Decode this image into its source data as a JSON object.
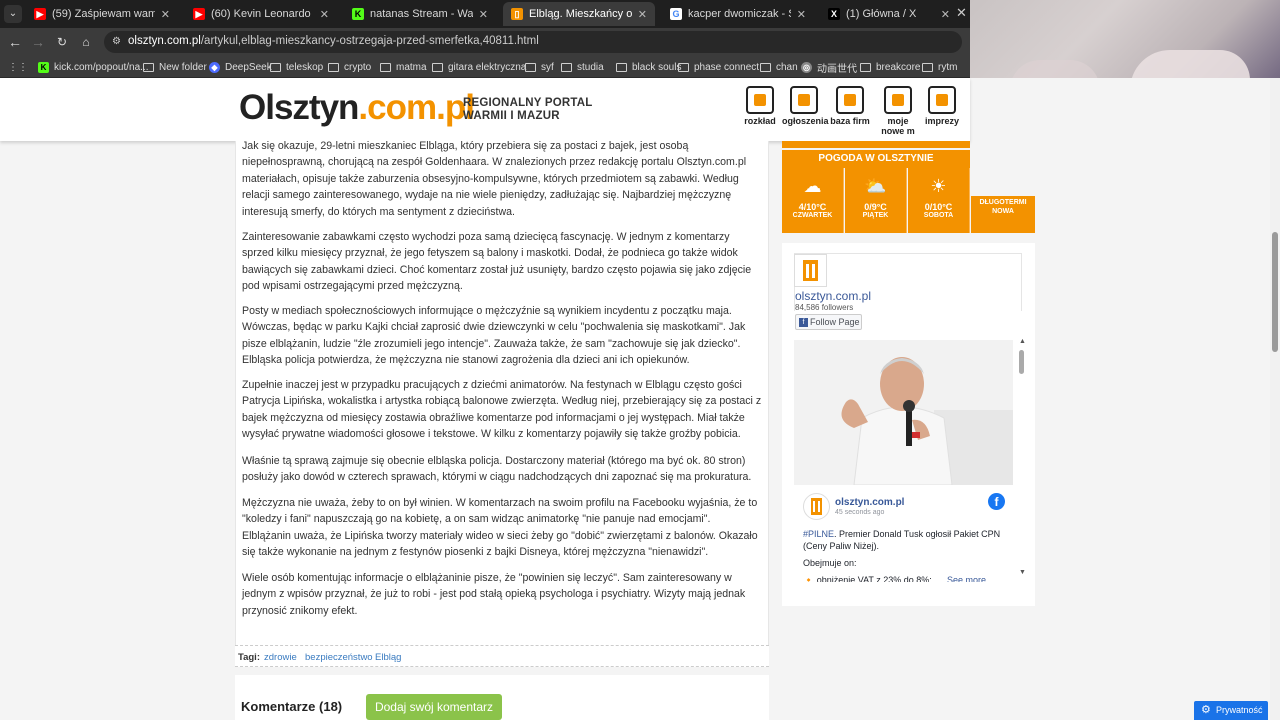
{
  "browser": {
    "tabs": [
      {
        "title": "(59) Zaśpiewam wam utwór Bu",
        "favicon_color": "#ff0000",
        "favicon_glyph": "▶",
        "active": false
      },
      {
        "title": "(60) Kevin Leonardo - YouTube",
        "favicon_color": "#ff0000",
        "favicon_glyph": "▶",
        "active": false
      },
      {
        "title": "natanas Stream - Watch Live on",
        "favicon_color": "#53fc18",
        "favicon_glyph": "K",
        "active": false
      },
      {
        "title": "Elbląg. Mieszkańcy ostrzegają p",
        "favicon_color": "#f39200",
        "favicon_glyph": "▯",
        "active": true
      },
      {
        "title": "kacper dwomiczak - Szukaj w G",
        "favicon_color": "#ffffff",
        "favicon_glyph": "G",
        "active": false
      },
      {
        "title": "(1) Główna / X",
        "favicon_color": "#000000",
        "favicon_glyph": "X",
        "active": false
      }
    ],
    "url_domain": "olsztyn.com.pl",
    "url_path": "/artykul,elblag-mieszkancy-ostrzegaja-przed-smerfetka,40811.html",
    "bookmarks": [
      {
        "label": "kick.com/popout/na...",
        "type": "kick",
        "color": "#53fc18"
      },
      {
        "label": "New folder",
        "type": "folder"
      },
      {
        "label": "DeepSeek",
        "type": "deepseek",
        "color": "#4d6bfe"
      },
      {
        "label": "teleskop",
        "type": "folder"
      },
      {
        "label": "crypto",
        "type": "folder"
      },
      {
        "label": "matma",
        "type": "folder"
      },
      {
        "label": "gitara elektryczna",
        "type": "folder"
      },
      {
        "label": "syf",
        "type": "folder"
      },
      {
        "label": "studia",
        "type": "folder"
      },
      {
        "label": "black souls",
        "type": "folder"
      },
      {
        "label": "phase connect",
        "type": "folder"
      },
      {
        "label": "chan",
        "type": "folder"
      },
      {
        "label": "动画世代",
        "type": "globe",
        "color": "#888888"
      },
      {
        "label": "breakcore",
        "type": "folder"
      },
      {
        "label": "rytm",
        "type": "folder"
      }
    ]
  },
  "site": {
    "logo_main": "Olsztyn",
    "logo_accent": ".com.pl",
    "tagline_line1": "REGIONALNY PORTAL",
    "tagline_line2": "WARMII I MAZUR",
    "nav": [
      {
        "label": "rozkład",
        "icon": "tram-icon"
      },
      {
        "label": "ogłoszenia",
        "icon": "ads-icon"
      },
      {
        "label": "baza firm",
        "icon": "list-icon"
      },
      {
        "label": "moje\nnowe m",
        "icon": "house-icon"
      },
      {
        "label": "imprezy",
        "icon": "ticket-icon"
      }
    ]
  },
  "article": {
    "paragraphs": [
      "Jak się okazuje, 29-letni mieszkaniec Elbląga, który przebiera się za postaci z bajek, jest osobą niepełnosprawną, chorującą na zespół Goldenhaara. W znalezionych przez redakcję portalu Olsztyn.com.pl materiałach, opisuje także zaburzenia obsesyjno-kompulsywne, których przedmiotem są zabawki. Według relacji samego zainteresowanego, wydaje na nie wiele pieniędzy, zadłużając się. Najbardziej mężczyznę interesują smerfy, do których ma sentyment z dzieciństwa.",
      "Zainteresowanie zabawkami często wychodzi poza samą dziecięcą fascynację. W jednym z komentarzy sprzed kilku miesięcy przyznał, że jego fetyszem są balony i maskotki. Dodał, że podnieca go także widok bawiących się zabawkami dzieci. Choć komentarz został już usunięty, bardzo często pojawia się jako zdjęcie pod wpisami ostrzegającymi przed mężczyzną.",
      "Posty w mediach społecznościowych informujące o mężczyźnie są wynikiem incydentu z początku maja. Wówczas, będąc w parku Kajki chciał zaprosić dwie dziewczynki w celu \"pochwalenia się maskotkami\". Jak pisze elblążanin, ludzie \"źle zrozumieli jego intencje\". Zauważa także, że sam \"zachowuje się jak dziecko\". Elbląska policja potwierdza, że mężczyzna nie stanowi zagrożenia dla dzieci ani ich opiekunów.",
      "Zupełnie inaczej jest w przypadku pracujących z dziećmi animatorów. Na festynach w Elblągu często gości Patrycja Lipińska, wokalistka i artystka robiącą balonowe zwierzęta. Według niej, przebierający się za postaci z bajek mężczyzna od miesięcy zostawia obraźliwe komentarze pod informacjami o jej występach. Miał także wysyłać prywatne wiadomości głosowe i tekstowe. W kilku z komentarzy pojawiły się także groźby pobicia.",
      "Właśnie tą sprawą zajmuje się obecnie elbląska policja. Dostarczony materiał (którego ma być ok. 80 stron) posłuży jako dowód w czterech sprawach, którymi w ciągu nadchodzących dni zapoznać się ma prokuratura.",
      "Mężczyzna nie uważa, żeby to on był winien. W komentarzach na swoim profilu na Facebooku wyjaśnia, że to \"koledzy i fani\" napuszczają go na kobietę, a on sam widząc animatorkę \"nie panuje nad emocjami\". Elblążanin uważa, że Lipińska tworzy materiały wideo w sieci żeby go \"dobić\" zwierzętami z balonów. Okazało się także wykonanie na jednym z festynów piosenki z bajki Disneya, której mężczyzna \"nienawidzi\".",
      "Wiele osób komentując informacje o elblążaninie pisze, że \"powinien się leczyć\". Sam zainteresowany w jednym z wpisów przyznał, że już to robi - jest pod stałą opieką psychologa i psychiatry. Wizyty mają jednak przynosić znikomy efekt."
    ],
    "tags_label": "Tagi:",
    "tags": [
      "zdrowie",
      "bezpieczeństwo",
      "Elbląg"
    ],
    "comments_title": "Komentarze (18)",
    "add_comment_label": "Dodaj swój komentarz"
  },
  "weather": {
    "title": "POGODA W OLSZTYNIE",
    "days": [
      {
        "temp": "4/10°C",
        "day": "CZWARTEK",
        "icon": "cloud-icon"
      },
      {
        "temp": "0/9°C",
        "day": "PIĄTEK",
        "icon": "partly-cloudy-icon"
      },
      {
        "temp": "0/10°C",
        "day": "SOBOTA",
        "icon": "sun-icon"
      }
    ],
    "long_term_line1": "DŁUGOTERMI",
    "long_term_line2": "NOWA"
  },
  "facebook": {
    "page_name": "olsztyn.com.pl",
    "followers": "84,586 followers",
    "follow_label": "Follow Page",
    "post_page": "olsztyn.com.pl",
    "post_time": "45 seconds ago",
    "post_hashtag": "#PILNE",
    "post_text": ". Premier Donald Tusk ogłosił Pakiet CPN (Ceny Paliw Niżej).",
    "post_line2": "Obejmuje on:",
    "post_line3": "🔸 obniżenie VAT z 23% do 8%;",
    "see_more": "See more"
  },
  "privacy_label": "Prywatność"
}
